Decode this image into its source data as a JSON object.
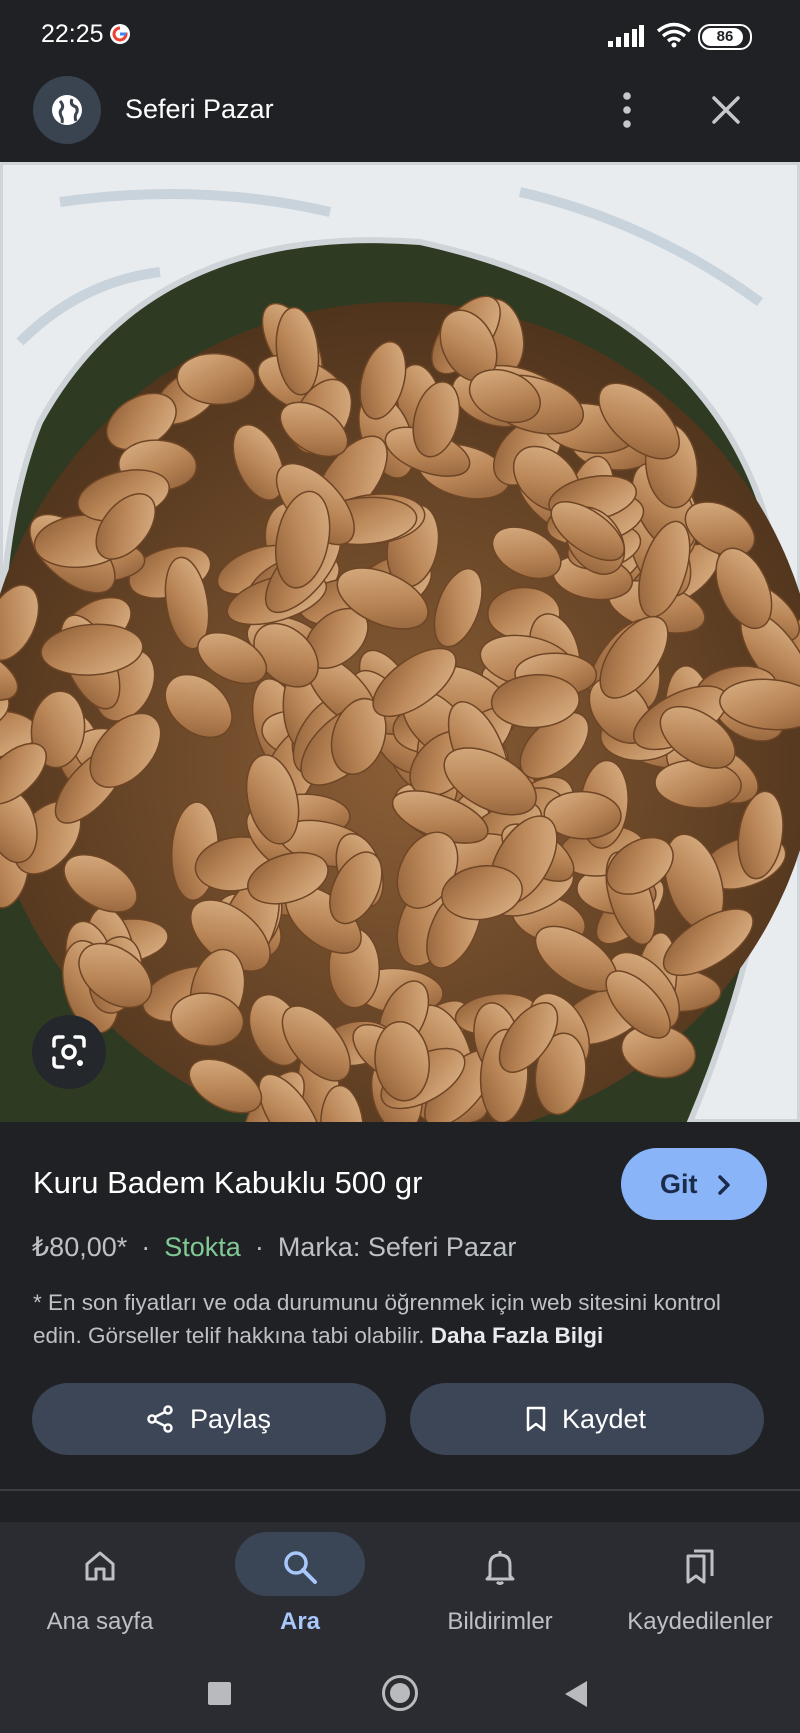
{
  "status_bar": {
    "time": "22:25",
    "battery": "86"
  },
  "header": {
    "site_name": "Seferi Pazar"
  },
  "product": {
    "title": "Kuru Badem Kabuklu 500 gr",
    "go_label": "Git",
    "price": "₺80,00*",
    "separator": "·",
    "stock": "Stokta",
    "brand": "Marka: Seferi Pazar",
    "disclaimer": "* En son fiyatları ve oda durumunu öğrenmek için web sitesini kontrol edin. Görseller telif hakkına tabi olabilir.",
    "more_info": "Daha Fazla Bilgi"
  },
  "actions": {
    "share_label": "Paylaş",
    "save_label": "Kaydet"
  },
  "bottom_nav": {
    "items": [
      {
        "label": "Ana sayfa",
        "icon": "home-icon"
      },
      {
        "label": "Ara",
        "icon": "search-icon",
        "active": true
      },
      {
        "label": "Bildirimler",
        "icon": "bell-icon"
      },
      {
        "label": "Kaydedilenler",
        "icon": "bookmarks-icon"
      }
    ]
  },
  "colors": {
    "background": "#1f2125",
    "accent": "#8ab4f8",
    "stock_green": "#81c995",
    "button_bg": "#3c4656"
  }
}
